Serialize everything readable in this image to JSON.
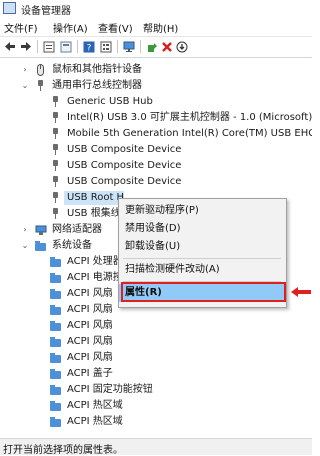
{
  "window": {
    "title": "设备管理器"
  },
  "menu": [
    "文件(F)",
    "操作(A)",
    "查看(V)",
    "帮助(H)"
  ],
  "toolbar": {
    "buttons": [
      "back-icon",
      "forward-icon",
      "properties-view-icon",
      "list-view-icon",
      "help-icon",
      "details-icon",
      "monitor-icon",
      "update-driver-icon",
      "uninstall-icon",
      "disable-icon"
    ]
  },
  "tree": {
    "rows": [
      {
        "label": "鼠标和其他指针设备",
        "type": "category",
        "expanded": false
      },
      {
        "label": "通用串行总线控制器",
        "type": "category",
        "expanded": true
      },
      {
        "label": "Generic USB Hub",
        "type": "usb"
      },
      {
        "label": "Intel(R) USB 3.0 可扩展主机控制器 - 1.0 (Microsoft)",
        "type": "usb"
      },
      {
        "label": "Mobile 5th Generation Intel(R) Core(TM) USB EHCI C",
        "type": "usb"
      },
      {
        "label": "USB Composite Device",
        "type": "usb"
      },
      {
        "label": "USB Composite Device",
        "type": "usb"
      },
      {
        "label": "USB Composite Device",
        "type": "usb"
      },
      {
        "label": "USB Root H",
        "type": "usb",
        "selected": true
      },
      {
        "label": "USB 根集线器",
        "type": "usb"
      },
      {
        "label": "网络适配器",
        "type": "category",
        "expanded": false
      },
      {
        "label": "系统设备",
        "type": "category",
        "expanded": true
      },
      {
        "label": "ACPI 处理器",
        "type": "sys"
      },
      {
        "label": "ACPI 电源按",
        "type": "sys"
      },
      {
        "label": "ACPI 风扇",
        "type": "sys"
      },
      {
        "label": "ACPI 风扇",
        "type": "sys"
      },
      {
        "label": "ACPI 风扇",
        "type": "sys"
      },
      {
        "label": "ACPI 风扇",
        "type": "sys"
      },
      {
        "label": "ACPI 风扇",
        "type": "sys"
      },
      {
        "label": "ACPI 盖子",
        "type": "sys"
      },
      {
        "label": "ACPI 固定功能按钮",
        "type": "sys"
      },
      {
        "label": "ACPI 热区域",
        "type": "sys"
      },
      {
        "label": "ACPI 热区域",
        "type": "sys"
      }
    ]
  },
  "context_menu": {
    "items": [
      "更新驱动程序(P)",
      "禁用设备(D)",
      "卸载设备(U)",
      "扫描检测硬件改动(A)",
      "属性(R)"
    ],
    "highlighted": "属性(R)"
  },
  "status": {
    "text": "打开当前选择项的属性表。"
  },
  "colors": {
    "highlight": "#91c9f7",
    "annotation_red": "#e02020",
    "selection": "#cce4f7"
  }
}
